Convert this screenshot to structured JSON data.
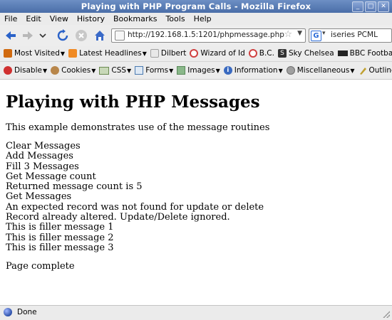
{
  "window": {
    "title": "Playing with PHP Program Calls - Mozilla Firefox"
  },
  "menu": [
    "File",
    "Edit",
    "View",
    "History",
    "Bookmarks",
    "Tools",
    "Help"
  ],
  "nav": {
    "url": "http://192.168.1.5:1201/phpmessage.php",
    "search_text": "iseries PCML"
  },
  "bookmarks": [
    {
      "label": "Most Visited",
      "icon": "most-visited-icon",
      "dropdown": true,
      "color": "#d06a10"
    },
    {
      "label": "Latest Headlines",
      "icon": "rss-icon",
      "dropdown": true,
      "color": "#f08a24"
    },
    {
      "label": "Dilbert",
      "icon": "dilbert-icon",
      "dropdown": false,
      "color": "#a0a0a0"
    },
    {
      "label": "Wizard of Id",
      "icon": "wizard-icon",
      "dropdown": false,
      "color": "#d04040"
    },
    {
      "label": "B.C.",
      "icon": "bc-icon",
      "dropdown": false,
      "color": "#d04040"
    },
    {
      "label": "Sky Chelsea",
      "icon": "sky-icon",
      "dropdown": false,
      "color": "#333"
    },
    {
      "label": "BBC Football",
      "icon": "bbc-icon",
      "dropdown": false,
      "color": "#222"
    }
  ],
  "bookmarks_more": "»",
  "devtools": [
    {
      "label": "Disable",
      "icon": "disable-icon",
      "color": "#d03030"
    },
    {
      "label": "Cookies",
      "icon": "cookie-icon",
      "color": "#b8864a"
    },
    {
      "label": "CSS",
      "icon": "css-icon",
      "color": "#6a8a50"
    },
    {
      "label": "Forms",
      "icon": "forms-icon",
      "color": "#4a7ab0"
    },
    {
      "label": "Images",
      "icon": "images-icon",
      "color": "#5a8a5a"
    },
    {
      "label": "Information",
      "icon": "information-icon",
      "color": "#3a6ac0"
    },
    {
      "label": "Miscellaneous",
      "icon": "miscellaneous-icon",
      "color": "#707070"
    },
    {
      "label": "Outline",
      "icon": "outline-icon",
      "color": "#c0a030"
    }
  ],
  "page": {
    "heading": "Playing with PHP Messages",
    "intro": "This example demonstrates use of the message routines",
    "lines": [
      "Clear Messages",
      "Add Messages",
      "Fill 3 Messages",
      "Get Message count",
      "Returned message count is 5",
      "Get Messages",
      "An expected record was not found for update or delete",
      "Record already altered. Update/Delete ignored.",
      "This is filler message 1",
      "This is filler message 2",
      "This is filler message 3"
    ],
    "footer": "Page complete"
  },
  "status": {
    "text": "Done"
  }
}
